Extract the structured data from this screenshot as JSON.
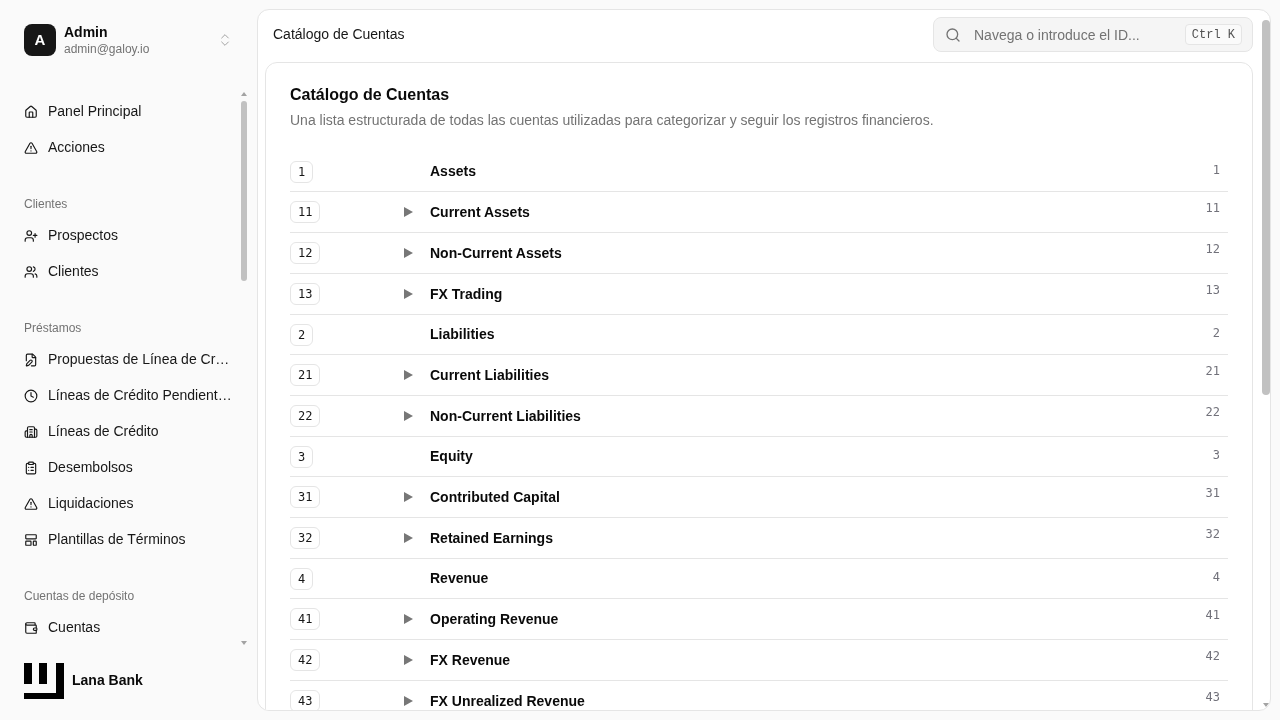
{
  "sidebar": {
    "user": {
      "avatar": "A",
      "name": "Admin",
      "email": "admin@galoy.io"
    },
    "sections": [
      {
        "items": [
          {
            "label": "Panel Principal"
          },
          {
            "label": "Acciones"
          }
        ]
      },
      {
        "title": "Clientes",
        "items": [
          {
            "label": "Prospectos"
          },
          {
            "label": "Clientes"
          }
        ]
      },
      {
        "title": "Préstamos",
        "items": [
          {
            "label": "Propuestas de Línea de Cr…"
          },
          {
            "label": "Líneas de Crédito Pendient…"
          },
          {
            "label": "Líneas de Crédito"
          },
          {
            "label": "Desembolsos"
          },
          {
            "label": "Liquidaciones"
          },
          {
            "label": "Plantillas de Términos"
          }
        ]
      },
      {
        "title": "Cuentas de depósito",
        "items": [
          {
            "label": "Cuentas"
          }
        ]
      }
    ],
    "brand": "Lana Bank"
  },
  "header": {
    "title": "Catálogo de Cuentas",
    "search": {
      "placeholder": "Navega o introduce el ID...",
      "shortcut": "Ctrl K"
    }
  },
  "card": {
    "title": "Catálogo de Cuentas",
    "description": "Una lista estructurada de todas las cuentas utilizadas para categorizar y seguir los registros financieros."
  },
  "accounts": [
    {
      "code": "1",
      "name": "Assets",
      "column_3": "1",
      "children": [
        {
          "code": "11",
          "name": "Current Assets",
          "column_3": "11",
          "expanded": false
        },
        {
          "code": "12",
          "name": "Non-Current Assets",
          "column_3": "12",
          "expanded": false
        },
        {
          "code": "13",
          "name": "FX Trading",
          "column_3": "13",
          "expanded": false
        }
      ]
    },
    {
      "code": "2",
      "name": "Liabilities",
      "column_3": "2",
      "children": [
        {
          "code": "21",
          "name": "Current Liabilities",
          "column_3": "21",
          "expanded": false
        },
        {
          "code": "22",
          "name": "Non-Current Liabilities",
          "column_3": "22",
          "expanded": false
        }
      ]
    },
    {
      "code": "3",
      "name": "Equity",
      "column_3": "3",
      "children": [
        {
          "code": "31",
          "name": "Contributed Capital",
          "column_3": "31",
          "expanded": false
        },
        {
          "code": "32",
          "name": "Retained Earnings",
          "column_3": "32",
          "expanded": false
        }
      ]
    },
    {
      "code": "4",
      "name": "Revenue",
      "column_3": "4",
      "children": [
        {
          "code": "41",
          "name": "Operating Revenue",
          "column_3": "41",
          "expanded": false
        },
        {
          "code": "42",
          "name": "FX Revenue",
          "column_3": "42",
          "expanded": false
        },
        {
          "code": "43",
          "name": "FX Unrealized Revenue",
          "column_3": "43",
          "expanded": false
        }
      ]
    }
  ]
}
